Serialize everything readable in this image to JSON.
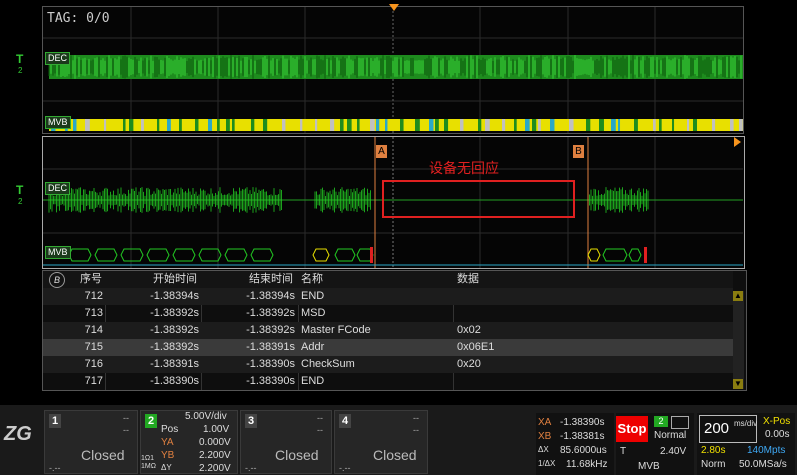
{
  "overview": {
    "tag": "TAG: 0/0",
    "dec_label": "DEC",
    "mvb_label": "MVB",
    "trigger_marker": "T",
    "ch_marker": "2"
  },
  "zoom": {
    "dec_label": "DEC",
    "mvb_label": "MVB",
    "cursor_a": "A",
    "cursor_b": "B",
    "annotation": "设备无回应",
    "trigger_marker": "T",
    "ch_marker": "2"
  },
  "table": {
    "icon": "B",
    "headers": [
      "序号",
      "开始时间",
      "结束时间",
      "名称",
      "数据"
    ],
    "rows": [
      {
        "idx": "712",
        "start": "-1.38394s",
        "end": "-1.38394s",
        "name": "END",
        "data": ""
      },
      {
        "idx": "713",
        "start": "-1.38392s",
        "end": "-1.38392s",
        "name": "MSD",
        "data": ""
      },
      {
        "idx": "714",
        "start": "-1.38392s",
        "end": "-1.38392s",
        "name": "Master FCode",
        "data": "0x02"
      },
      {
        "idx": "715",
        "start": "-1.38392s",
        "end": "-1.38391s",
        "name": "Addr",
        "data": "0x06E1"
      },
      {
        "idx": "716",
        "start": "-1.38391s",
        "end": "-1.38390s",
        "name": "CheckSum",
        "data": "0x20"
      },
      {
        "idx": "717",
        "start": "-1.38390s",
        "end": "-1.38390s",
        "name": "END",
        "data": ""
      }
    ]
  },
  "channels": {
    "ch1": {
      "num": "1",
      "status": "Closed",
      "top": "--",
      "mid": "--",
      "bot_l": "-.--",
      "bot_r": "--"
    },
    "ch2": {
      "num": "2",
      "scale": "5.00V/div",
      "pos_label": "Pos",
      "pos": "1.00V",
      "ya_label": "YA",
      "ya": "0.000V",
      "yb_label": "YB",
      "yb": "2.200V",
      "dy_label": "ΔY",
      "dy": "2.200V",
      "coupling1": "1Ω1",
      "coupling2": "1MΩ"
    },
    "ch3": {
      "num": "3",
      "status": "Closed",
      "top": "--",
      "mid": "--",
      "bot_l": "-.--",
      "bot_r": "--"
    },
    "ch4": {
      "num": "4",
      "status": "Closed",
      "top": "--",
      "mid": "--",
      "bot_l": "-.--",
      "bot_r": "--"
    }
  },
  "cursors": {
    "xa_label": "XA",
    "xa": "-1.38390s",
    "xb_label": "XB",
    "xb": "-1.38381s",
    "dx_label": "ΔX",
    "dx": "85.6000us",
    "inv_label": "1/ΔX",
    "inv": "11.68kHz"
  },
  "trigger": {
    "state": "Stop",
    "source": "2",
    "mode": "Normal",
    "type_label": "T",
    "level": "2.40V",
    "decoder": "MVB"
  },
  "timebase": {
    "value": "200",
    "unit": "ms/div",
    "sub1": "2.80s",
    "sub2": "140Mpts",
    "mode": "Norm",
    "rate": "50.0MSa/s",
    "xpos_label": "X-Pos",
    "xpos": "0.00s"
  },
  "colors": {
    "trace": "#22c922",
    "mvb_yellow": "#f0e000",
    "cursor": "#e08040",
    "annotation": "#e02020",
    "accent_orange": "#f7941d"
  }
}
